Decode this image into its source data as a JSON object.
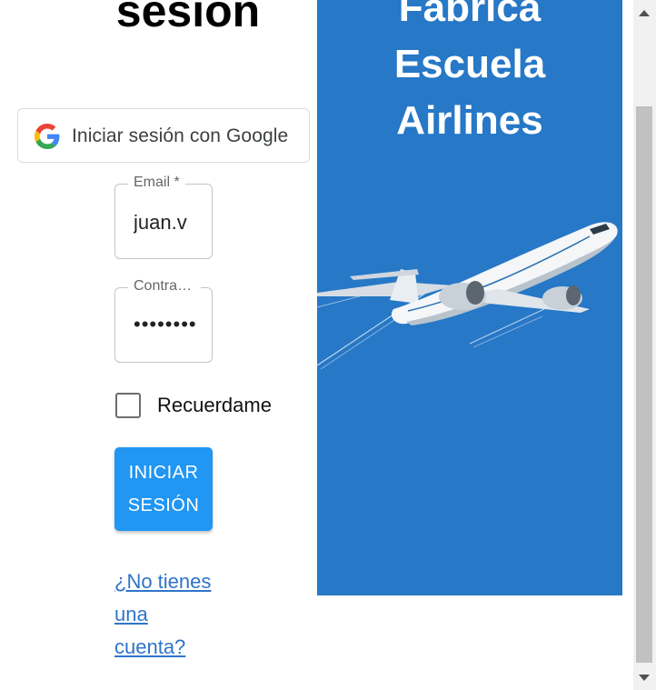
{
  "page": {
    "heading": "sesión"
  },
  "google_button": {
    "label": "Iniciar sesión con Google",
    "icon": "google-g-icon"
  },
  "form": {
    "email": {
      "label": "Email *",
      "value": "juan.v"
    },
    "password": {
      "label": "Contraseña *",
      "value": "••••••••"
    },
    "remember": {
      "label": "Recuerdame",
      "checked": false
    },
    "submit_label": "INICIAR SESIÓN",
    "signup_link": "¿No tienes una cuenta?"
  },
  "hero": {
    "title_lines": [
      "Fabrica",
      "Escuela",
      "Airlines"
    ],
    "background": "#2778c6",
    "image": "airplane"
  },
  "colors": {
    "primary_button": "#2196f3",
    "link": "#2f74c9"
  }
}
